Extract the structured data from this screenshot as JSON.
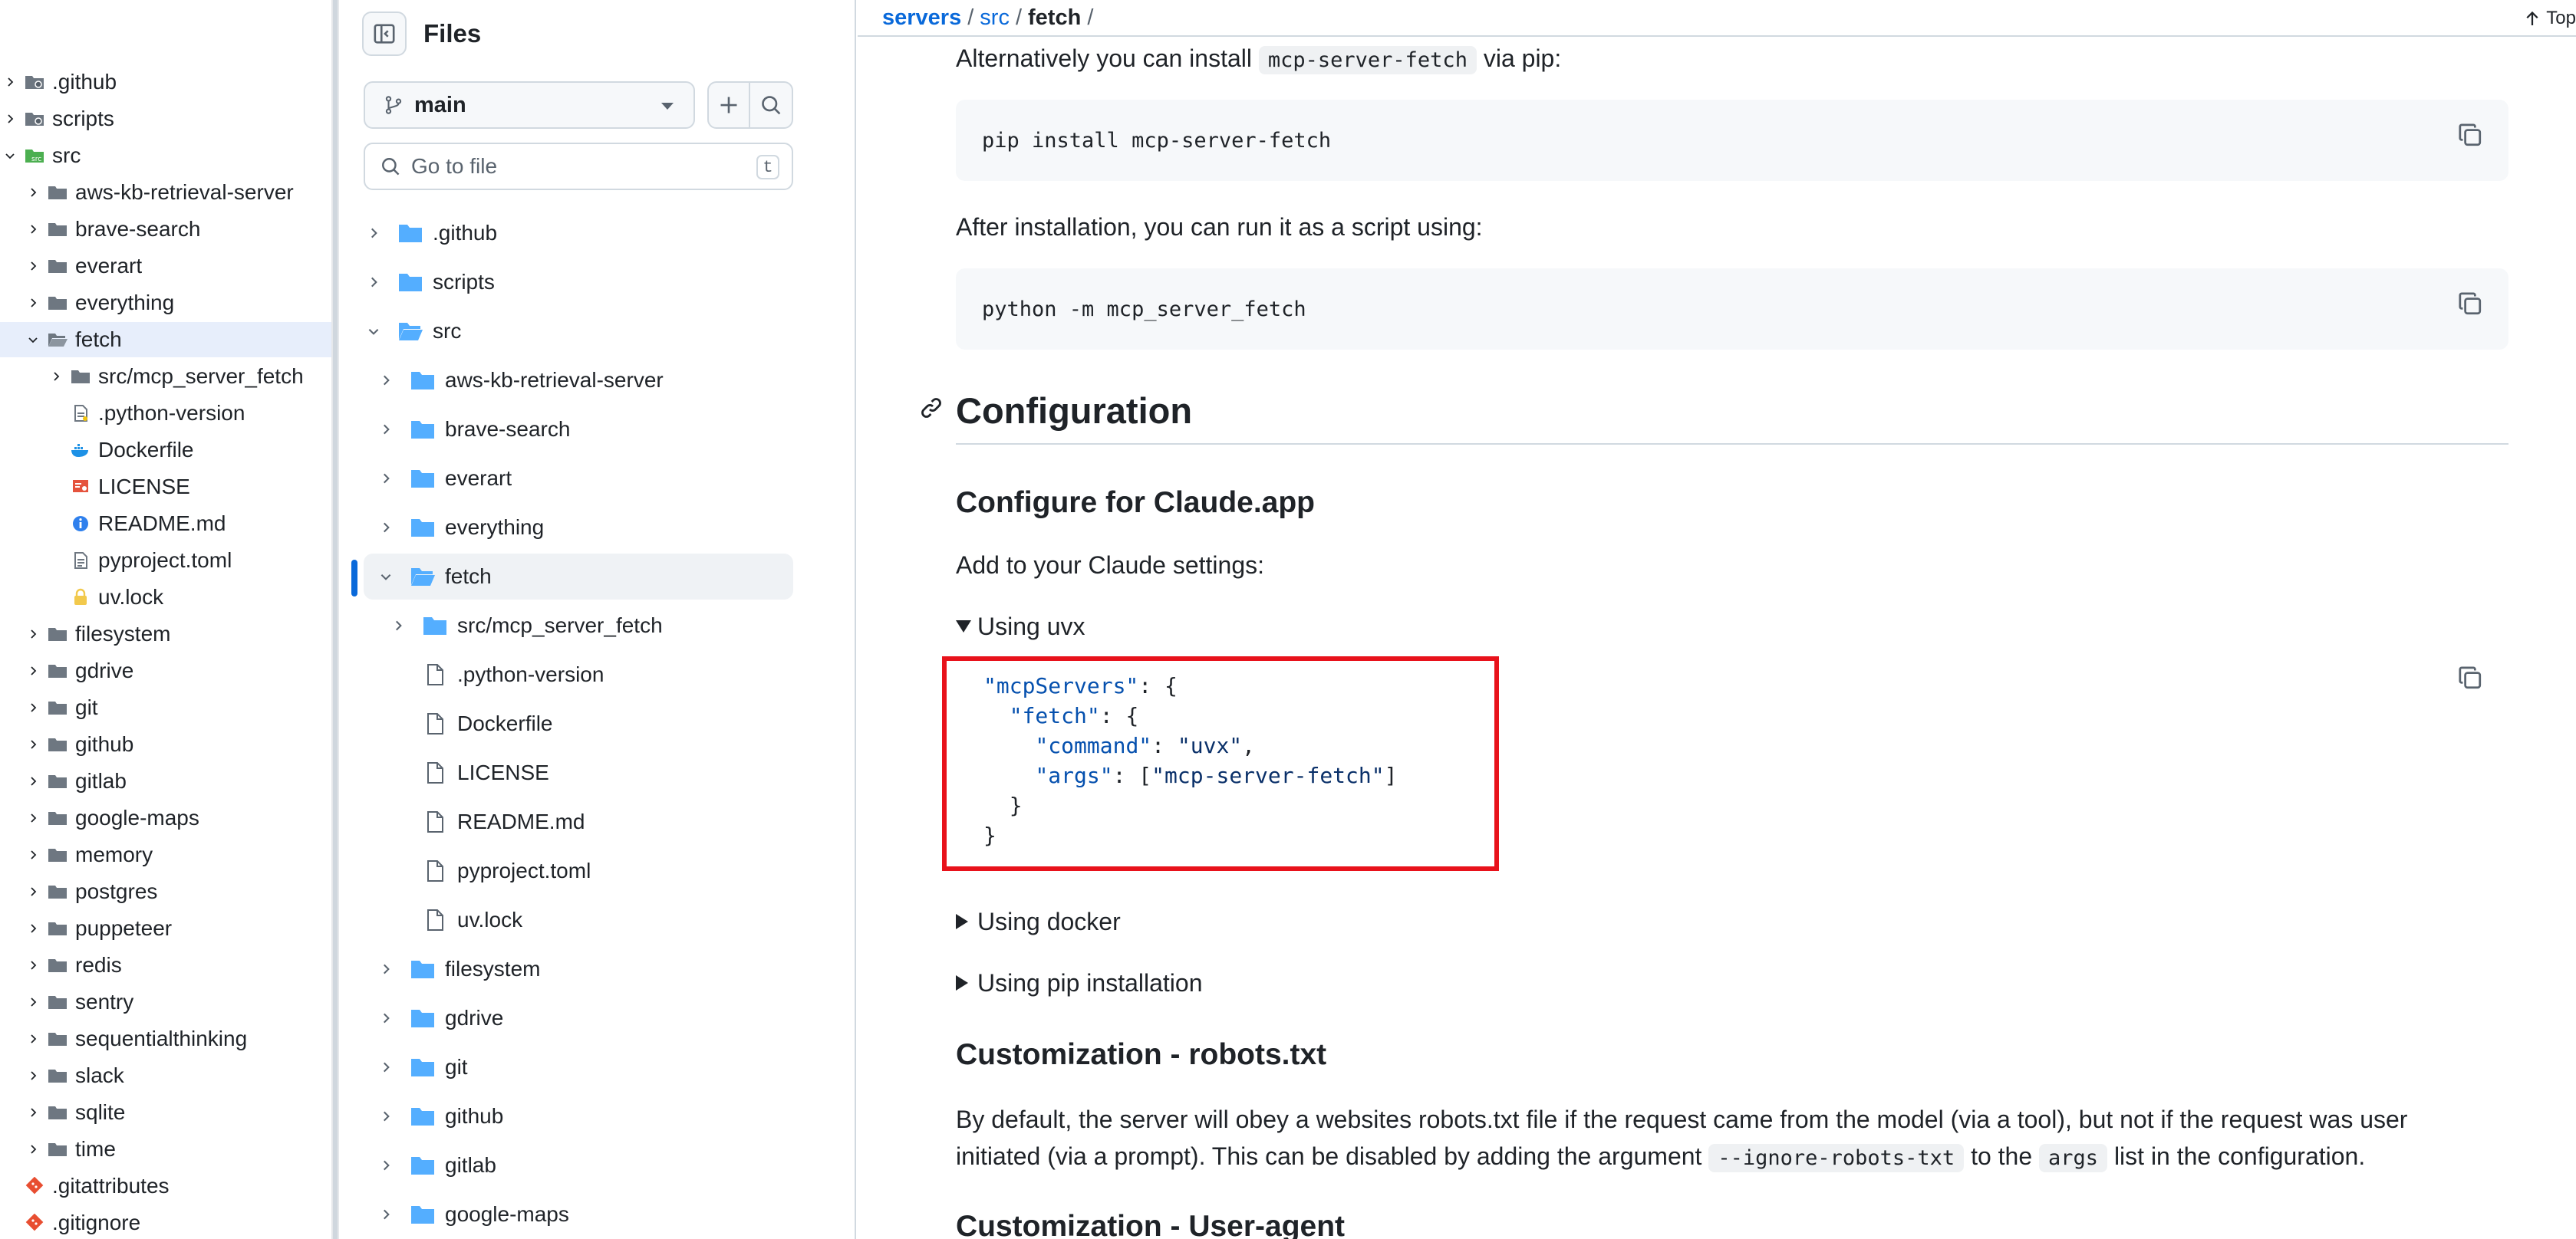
{
  "left_tree": {
    "items": [
      {
        "label": ".github",
        "kind": "folder-git",
        "depth": 0,
        "chevron": "right"
      },
      {
        "label": "scripts",
        "kind": "folder-git",
        "depth": 0,
        "chevron": "right"
      },
      {
        "label": "src",
        "kind": "folder-src",
        "depth": 0,
        "chevron": "down"
      },
      {
        "label": "aws-kb-retrieval-server",
        "kind": "folder",
        "depth": 1,
        "chevron": "right"
      },
      {
        "label": "brave-search",
        "kind": "folder",
        "depth": 1,
        "chevron": "right"
      },
      {
        "label": "everart",
        "kind": "folder",
        "depth": 1,
        "chevron": "right"
      },
      {
        "label": "everything",
        "kind": "folder",
        "depth": 1,
        "chevron": "right"
      },
      {
        "label": "fetch",
        "kind": "folder-open",
        "depth": 1,
        "chevron": "down",
        "selected": true
      },
      {
        "label": "src/mcp_server_fetch",
        "kind": "folder",
        "depth": 2,
        "chevron": "right"
      },
      {
        "label": ".python-version",
        "kind": "file-python",
        "depth": 2,
        "chevron": ""
      },
      {
        "label": "Dockerfile",
        "kind": "file-docker",
        "depth": 2,
        "chevron": ""
      },
      {
        "label": "LICENSE",
        "kind": "file-license",
        "depth": 2,
        "chevron": ""
      },
      {
        "label": "README.md",
        "kind": "file-info",
        "depth": 2,
        "chevron": ""
      },
      {
        "label": "pyproject.toml",
        "kind": "file-toml",
        "depth": 2,
        "chevron": ""
      },
      {
        "label": "uv.lock",
        "kind": "file-lock",
        "depth": 2,
        "chevron": ""
      },
      {
        "label": "filesystem",
        "kind": "folder",
        "depth": 1,
        "chevron": "right"
      },
      {
        "label": "gdrive",
        "kind": "folder",
        "depth": 1,
        "chevron": "right"
      },
      {
        "label": "git",
        "kind": "folder",
        "depth": 1,
        "chevron": "right"
      },
      {
        "label": "github",
        "kind": "folder",
        "depth": 1,
        "chevron": "right"
      },
      {
        "label": "gitlab",
        "kind": "folder",
        "depth": 1,
        "chevron": "right"
      },
      {
        "label": "google-maps",
        "kind": "folder",
        "depth": 1,
        "chevron": "right"
      },
      {
        "label": "memory",
        "kind": "folder",
        "depth": 1,
        "chevron": "right"
      },
      {
        "label": "postgres",
        "kind": "folder",
        "depth": 1,
        "chevron": "right"
      },
      {
        "label": "puppeteer",
        "kind": "folder",
        "depth": 1,
        "chevron": "right"
      },
      {
        "label": "redis",
        "kind": "folder",
        "depth": 1,
        "chevron": "right"
      },
      {
        "label": "sentry",
        "kind": "folder",
        "depth": 1,
        "chevron": "right"
      },
      {
        "label": "sequentialthinking",
        "kind": "folder",
        "depth": 1,
        "chevron": "right"
      },
      {
        "label": "slack",
        "kind": "folder",
        "depth": 1,
        "chevron": "right"
      },
      {
        "label": "sqlite",
        "kind": "folder",
        "depth": 1,
        "chevron": "right"
      },
      {
        "label": "time",
        "kind": "folder",
        "depth": 1,
        "chevron": "right"
      },
      {
        "label": ".gitattributes",
        "kind": "file-git",
        "depth": 0,
        "chevron": ""
      },
      {
        "label": ".gitignore",
        "kind": "file-git",
        "depth": 0,
        "chevron": ""
      }
    ]
  },
  "files_panel": {
    "title": "Files",
    "branch": "main",
    "goto_placeholder": "Go to file",
    "goto_shortcut": "t",
    "items": [
      {
        "label": ".github",
        "kind": "folder",
        "depth": 0,
        "chevron": "right"
      },
      {
        "label": "scripts",
        "kind": "folder",
        "depth": 0,
        "chevron": "right"
      },
      {
        "label": "src",
        "kind": "folder-open",
        "depth": 0,
        "chevron": "down"
      },
      {
        "label": "aws-kb-retrieval-server",
        "kind": "folder",
        "depth": 1,
        "chevron": "right"
      },
      {
        "label": "brave-search",
        "kind": "folder",
        "depth": 1,
        "chevron": "right"
      },
      {
        "label": "everart",
        "kind": "folder",
        "depth": 1,
        "chevron": "right"
      },
      {
        "label": "everything",
        "kind": "folder",
        "depth": 1,
        "chevron": "right"
      },
      {
        "label": "fetch",
        "kind": "folder-open",
        "depth": 1,
        "chevron": "down",
        "selected": true
      },
      {
        "label": "src/mcp_server_fetch",
        "kind": "folder",
        "depth": 2,
        "chevron": "right"
      },
      {
        "label": ".python-version",
        "kind": "file",
        "depth": 2,
        "chevron": ""
      },
      {
        "label": "Dockerfile",
        "kind": "file",
        "depth": 2,
        "chevron": ""
      },
      {
        "label": "LICENSE",
        "kind": "file",
        "depth": 2,
        "chevron": ""
      },
      {
        "label": "README.md",
        "kind": "file",
        "depth": 2,
        "chevron": ""
      },
      {
        "label": "pyproject.toml",
        "kind": "file",
        "depth": 2,
        "chevron": ""
      },
      {
        "label": "uv.lock",
        "kind": "file",
        "depth": 2,
        "chevron": ""
      },
      {
        "label": "filesystem",
        "kind": "folder",
        "depth": 1,
        "chevron": "right"
      },
      {
        "label": "gdrive",
        "kind": "folder",
        "depth": 1,
        "chevron": "right"
      },
      {
        "label": "git",
        "kind": "folder",
        "depth": 1,
        "chevron": "right"
      },
      {
        "label": "github",
        "kind": "folder",
        "depth": 1,
        "chevron": "right"
      },
      {
        "label": "gitlab",
        "kind": "folder",
        "depth": 1,
        "chevron": "right"
      },
      {
        "label": "google-maps",
        "kind": "folder",
        "depth": 1,
        "chevron": "right"
      }
    ]
  },
  "breadcrumb": {
    "repo": "servers",
    "dir": "src",
    "current": "fetch",
    "sep": "/",
    "top_label": "Top"
  },
  "readme": {
    "alt_install_pre": "Alternatively you can install ",
    "alt_install_code": "mcp-server-fetch",
    "alt_install_post": " via pip:",
    "pip_cmd": "pip install mcp-server-fetch",
    "after_install": "After installation, you can run it as a script using:",
    "run_cmd": "python -m mcp_server_fetch",
    "config_heading": "Configuration",
    "claude_heading": "Configure for Claude.app",
    "add_settings": "Add to your Claude settings:",
    "details_uvx": "Using uvx",
    "json_lines": [
      {
        "indent": "",
        "key": "\"mcpServers\"",
        "rest": ": {"
      },
      {
        "indent": "  ",
        "key": "\"fetch\"",
        "rest": ": {"
      },
      {
        "indent": "    ",
        "key": "\"command\"",
        "rest": ": \"uvx\","
      },
      {
        "indent": "    ",
        "key": "\"args\"",
        "rest": ": [\"mcp-server-fetch\"]"
      },
      {
        "indent": "  ",
        "key": "",
        "rest": "}"
      },
      {
        "indent": "",
        "key": "",
        "rest": "}"
      }
    ],
    "details_docker": "Using docker",
    "details_pip": "Using pip installation",
    "robots_heading": "Customization - robots.txt",
    "robots_p1": "By default, the server will obey a websites robots.txt file if the request came from the model (via a tool), but not if the request was user",
    "robots_p2_pre": "initiated (via a prompt). This can be disabled by adding the argument ",
    "robots_p2_code1": "--ignore-robots-txt",
    "robots_p2_mid": " to the ",
    "robots_p2_code2": "args",
    "robots_p2_post": " list in the configuration.",
    "useragent_heading": "Customization - User-agent"
  },
  "colors": {
    "link": "#0969da",
    "folder": "#54aeff",
    "highlight_box": "#e8121b",
    "selected_row": "#e7eefb"
  }
}
